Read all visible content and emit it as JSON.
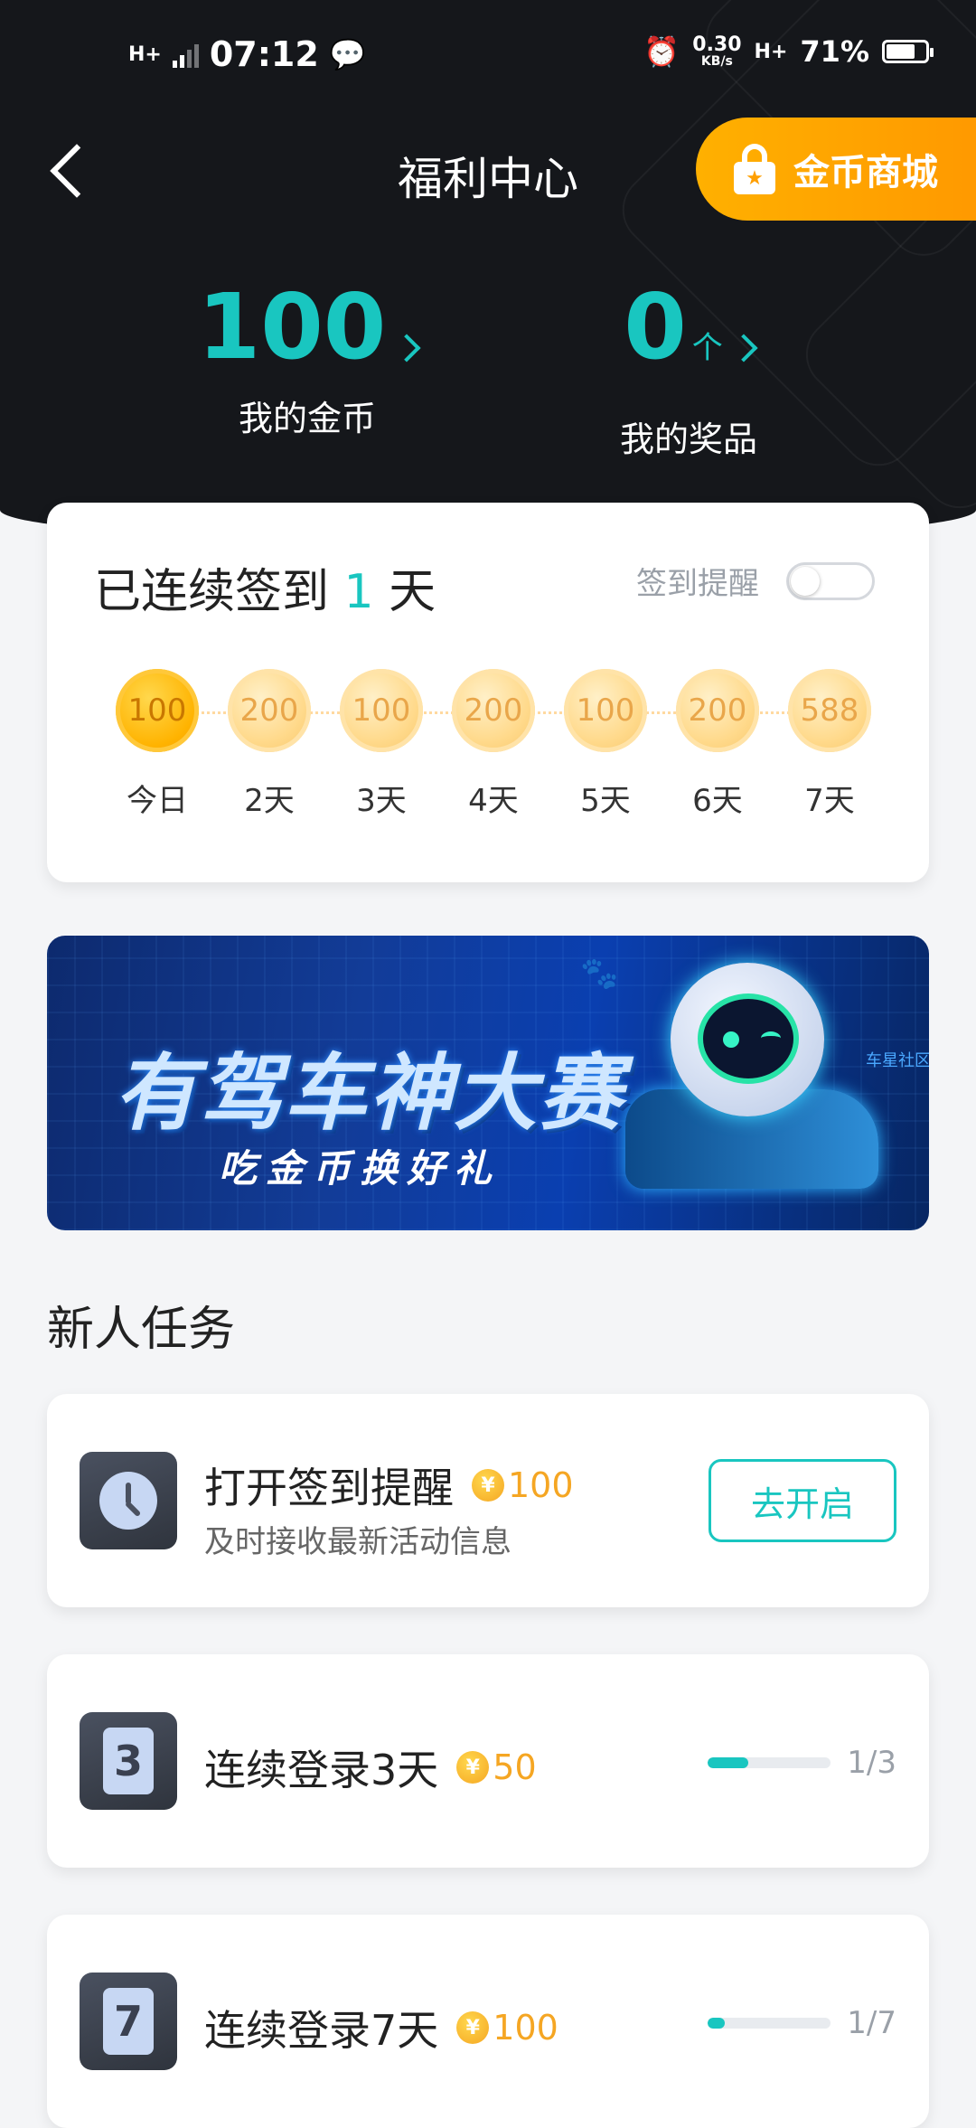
{
  "status_bar": {
    "time": "07:12",
    "signal_left": "H+",
    "net_speed": "0.30",
    "net_unit": "KB/s",
    "signal_right": "H+",
    "battery": "71%",
    "battery_level": 0.71
  },
  "header": {
    "title": "福利中心",
    "mall_button": "金币商城",
    "stats": [
      {
        "value": "100",
        "unit": "",
        "label": "我的金币"
      },
      {
        "value": "0",
        "unit": "个",
        "label": "我的奖品"
      }
    ]
  },
  "signin": {
    "prefix": "已连续签到",
    "days": "1",
    "suffix": "天",
    "remind_label": "签到提醒",
    "remind_on": false,
    "days_list": [
      {
        "coins": "100",
        "label": "今日",
        "active": true
      },
      {
        "coins": "200",
        "label": "2天",
        "active": false
      },
      {
        "coins": "100",
        "label": "3天",
        "active": false
      },
      {
        "coins": "200",
        "label": "4天",
        "active": false
      },
      {
        "coins": "100",
        "label": "5天",
        "active": false
      },
      {
        "coins": "200",
        "label": "6天",
        "active": false
      },
      {
        "coins": "588",
        "label": "7天",
        "active": false
      }
    ]
  },
  "banner": {
    "title": "有驾车神大赛",
    "subtitle": "吃金币换好礼",
    "side_text": "车星社区"
  },
  "section_title": "新人任务",
  "tasks": [
    {
      "name": "打开签到提醒",
      "reward": "100",
      "subtitle": "及时接收最新活动信息",
      "button": "去开启"
    },
    {
      "name": "连续登录3天",
      "reward": "50",
      "icon_digit": "3",
      "progress_text": "1/3",
      "progress": 0.33
    },
    {
      "name": "连续登录7天",
      "reward": "100",
      "icon_digit": "7",
      "progress_text": "1/7",
      "progress": 0.14
    }
  ],
  "coin_symbol": "¥",
  "colors": {
    "accent": "#19c6c0",
    "orange": "#ff9f00",
    "coin": "#f5a623",
    "header_bg": "#15171b"
  }
}
